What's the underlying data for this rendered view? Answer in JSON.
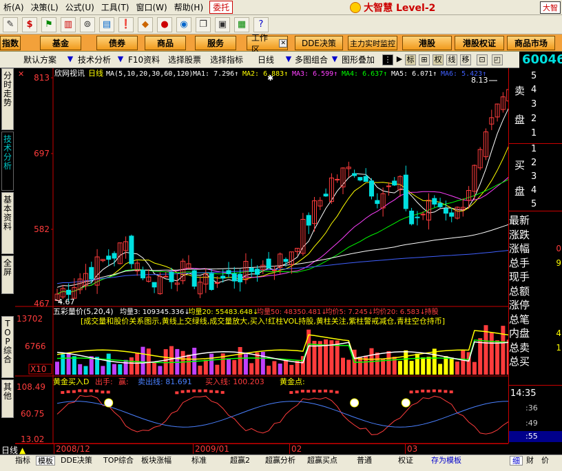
{
  "menu": {
    "items": [
      "析(A)",
      "决策(L)",
      "公式(U)",
      "工具(T)",
      "窗口(W)",
      "帮助(H)"
    ],
    "active": "委托",
    "brand": "大智慧 Level-2",
    "corner": "大智"
  },
  "nav": {
    "buttons": [
      "指数",
      "基金",
      "债券",
      "商品",
      "服务",
      "工作区",
      "DDE决策",
      "主力实时监控",
      "港股",
      "港股权证",
      "商品市场"
    ]
  },
  "subbar": {
    "items": [
      "默认方案",
      "技术分析",
      "F10资料",
      "选择股票",
      "选择指标",
      "日线",
      "多图组合",
      "图形叠加"
    ],
    "toggles": [
      "标",
      "权",
      "线",
      "移"
    ],
    "code": "60046"
  },
  "left_tabs": [
    "分时走势",
    "技术分析",
    "基本资料",
    "全屏",
    "TOP综合",
    "其他"
  ],
  "main_chart": {
    "source": "欣网视讯",
    "period": "日线",
    "ma_label": "MA(5,10,20,30,60,120)",
    "ma": [
      {
        "name": "MA1:",
        "value": "7.296",
        "color": "#ffffff"
      },
      {
        "name": "MA2:",
        "value": "6.883",
        "color": "#ffff00"
      },
      {
        "name": "MA3:",
        "value": "6.599",
        "color": "#ff40ff"
      },
      {
        "name": "MA4:",
        "value": "6.637",
        "color": "#00ff00"
      },
      {
        "name": "MA5:",
        "value": "6.071",
        "color": "#ffffff"
      },
      {
        "name": "MA6:",
        "value": "5.423",
        "color": "#4060ff"
      }
    ],
    "y_labels": [
      "813",
      "697",
      "582",
      "467"
    ],
    "high_marker": "8.13",
    "low_marker": "4.67"
  },
  "volume_chart": {
    "title": "五彩量价(5,20,4)",
    "stats": [
      {
        "text": "均量3: 109345.336",
        "color": "#ffffff"
      },
      {
        "text": "均量20: 55483.648",
        "color": "#ffff00"
      },
      {
        "text": "均量50: 48350.481",
        "color": "#ff4040"
      },
      {
        "text": "均价5: 7.245",
        "color": "#ff4040"
      },
      {
        "text": "均价20: 6.583",
        "color": "#ff4040"
      },
      {
        "text": "持股",
        "color": "#ff4040"
      }
    ],
    "note": "[成交量和股价关系图示,黄线上交绿线,成交量放大,买入!红柱VOL持股,黄柱关注,紫柱警戒减仓,青柱空仓持币]",
    "y_labels": [
      "13702",
      "6766",
      "X10"
    ]
  },
  "indicator_chart": {
    "title": "黄金买入D",
    "out": "出手:",
    "win": "赢:",
    "sell_line": "卖出线: 81.691",
    "buy_line": "买入线: 100.203",
    "gold_point": "黄金点:",
    "y_labels": [
      "108.49",
      "60.75",
      "13.02"
    ]
  },
  "time_axis": [
    "2008/12",
    "2009/01",
    "02",
    "03"
  ],
  "period_tab": "日线",
  "right_panel": {
    "sell_label": [
      "卖",
      "盘"
    ],
    "buy_label": [
      "买",
      "盘"
    ],
    "sell_nums": [
      "5",
      "4",
      "3",
      "2",
      "1"
    ],
    "buy_nums": [
      "1",
      "2",
      "3",
      "4",
      "5"
    ],
    "fields": [
      "最新",
      "涨跌",
      "涨幅",
      "总手",
      "现手",
      "总额",
      "涨停",
      "总笔",
      "内盘",
      "总卖",
      "总买"
    ],
    "field_values": [
      "",
      "",
      "0",
      "9",
      "",
      "",
      "",
      "",
      "4",
      "1",
      ""
    ],
    "times": [
      "14:35",
      ":36",
      ":49",
      ":55"
    ],
    "bottom_tabs": [
      "细",
      "财",
      "价"
    ]
  },
  "bottom_tabs": [
    "指标",
    "模板",
    "DDE决策",
    "TOP综合",
    "板块涨幅",
    "标准",
    "超赢2",
    "超赢分析",
    "超赢买点",
    "普通",
    "权证",
    "存为模板"
  ],
  "colors": {
    "up": "#ff3c3c",
    "down": "#00e0e0",
    "orange": "#f3a13a",
    "axis": "#c00000"
  }
}
